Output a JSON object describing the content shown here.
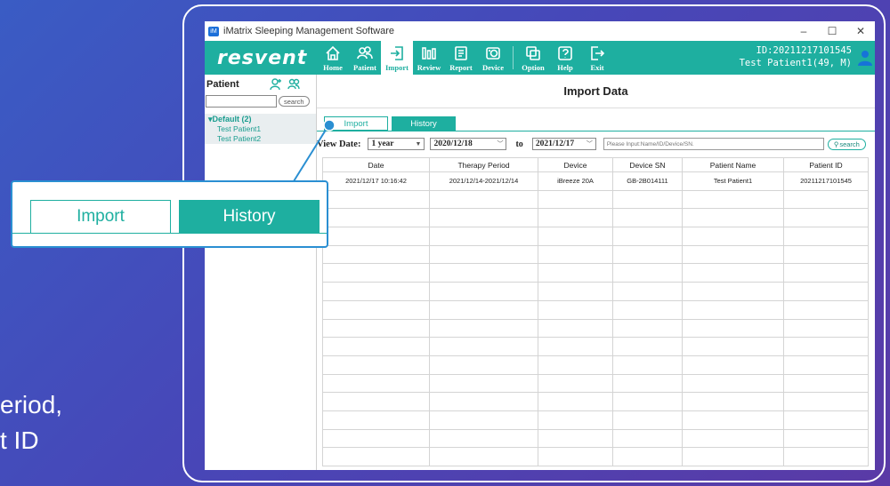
{
  "background_caption": [
    "eriod,",
    "t ID"
  ],
  "window": {
    "title": "iMatrix Sleeping Management Software",
    "app_icon_label": "iM",
    "controls": [
      "–",
      "☐",
      "✕"
    ]
  },
  "toolbar": {
    "brand": "resvent",
    "buttons": [
      {
        "label": "Home",
        "icon": "home-icon"
      },
      {
        "label": "Patient",
        "icon": "patient-icon"
      },
      {
        "label": "Import",
        "icon": "import-icon",
        "active": true
      },
      {
        "label": "Review",
        "icon": "review-icon"
      },
      {
        "label": "Report",
        "icon": "report-icon"
      },
      {
        "label": "Device",
        "icon": "device-icon"
      },
      {
        "label": "Option",
        "icon": "option-icon"
      },
      {
        "label": "Help",
        "icon": "help-icon"
      },
      {
        "label": "Exit",
        "icon": "exit-icon"
      }
    ],
    "user_id": "ID:20211217101545",
    "user_name": "Test Patient1(49, M)",
    "accent_color": "#1eafa0"
  },
  "sidebar": {
    "title": "Patient",
    "search_placeholder": "",
    "search_button": "search",
    "group": "▾Default (2)",
    "patients": [
      "Test Patient1",
      "Test Patient2"
    ]
  },
  "main": {
    "title": "Import Data",
    "tabs": [
      {
        "label": "Import",
        "active": false
      },
      {
        "label": "History",
        "active": true
      }
    ],
    "filter": {
      "view_date_label": "View Date:",
      "range": "1 year",
      "from": "2020/12/18",
      "to_label": "to",
      "to": "2021/12/17",
      "search_placeholder": "Please Input:Name/ID/Device/SN.",
      "search_button": "search"
    },
    "table": {
      "headers": [
        "Date",
        "Therapy Period",
        "Device",
        "Device SN",
        "Patient Name",
        "Patient ID"
      ],
      "rows": [
        [
          "2021/12/17 10:16:42",
          "2021/12/14-2021/12/14",
          "iBreeze 20A",
          "GB-2B014111",
          "Test Patient1",
          "20211217101545"
        ]
      ],
      "empty_rows": 15
    }
  },
  "callout": {
    "tabs": [
      "Import",
      "History"
    ]
  }
}
